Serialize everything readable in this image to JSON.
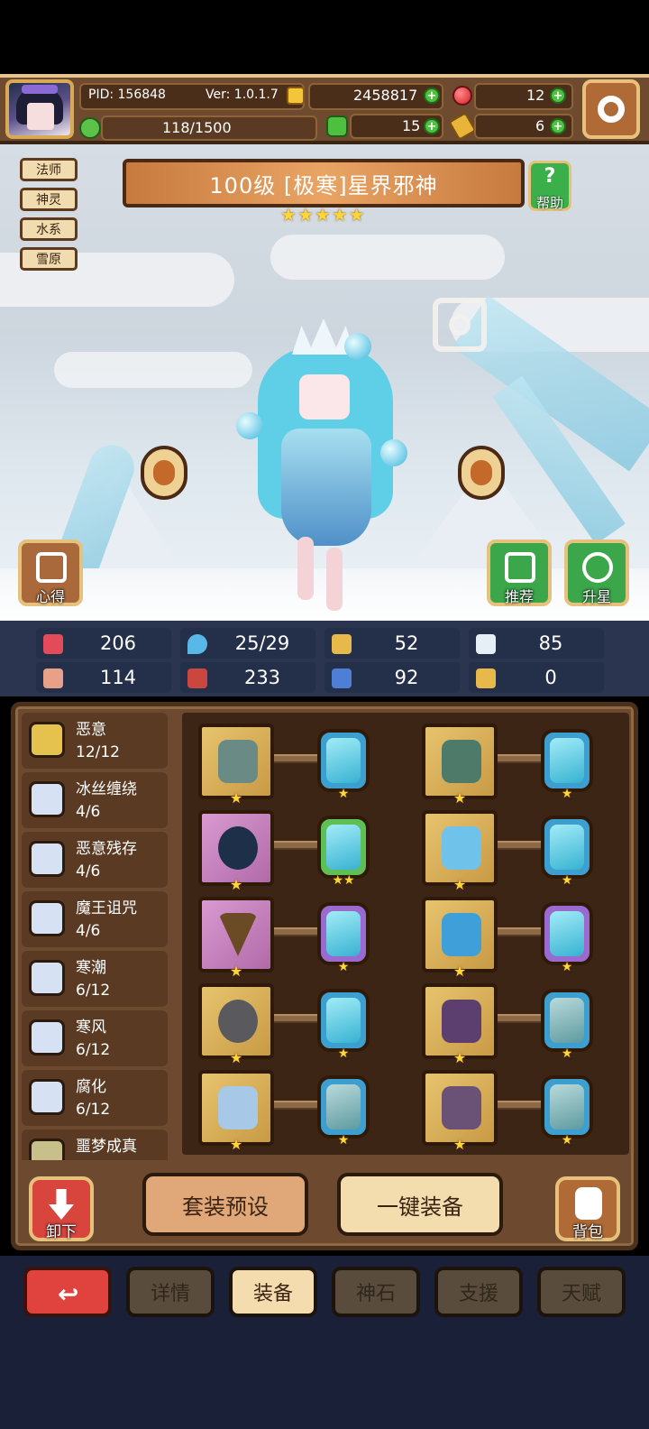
{
  "header": {
    "pid": "PID: 156848",
    "version": "Ver: 1.0.1.7",
    "gold": "2458817",
    "red_gems": "12",
    "energy": "118/1500",
    "clovers": "15",
    "keys": "6"
  },
  "tags": [
    "法师",
    "神灵",
    "水系",
    "雪原"
  ],
  "hero": {
    "title": "100级 [极寒]星界邪神",
    "stars": 5,
    "star_glyph": "★"
  },
  "buttons": {
    "help": "帮助",
    "notes": "心得",
    "recommend": "推荐",
    "star_up": "升星",
    "unequip": "卸下",
    "preset": "套装预设",
    "auto_equip": "一键装备",
    "bag": "背包"
  },
  "stats": [
    {
      "icon": "heart-icon",
      "value": "206",
      "color": "#e44b5a"
    },
    {
      "icon": "drop-icon",
      "value": "25/29",
      "color": "#5ab8e8"
    },
    {
      "icon": "shield-icon",
      "value": "52",
      "color": "#e7b84a"
    },
    {
      "icon": "wing-icon",
      "value": "85",
      "color": "#e6eef6"
    },
    {
      "icon": "fist-icon",
      "value": "114",
      "color": "#e6a188"
    },
    {
      "icon": "book-icon",
      "value": "233",
      "color": "#c9473e"
    },
    {
      "icon": "boot-icon",
      "value": "92",
      "color": "#4e7fd4"
    },
    {
      "icon": "horseshoe-icon",
      "value": "0",
      "color": "#e7b84a"
    }
  ],
  "sets": [
    {
      "name": "恶意",
      "count": "12/12",
      "color": "#e5c14e"
    },
    {
      "name": "冰丝缠绕",
      "count": "4/6",
      "color": "#d6e2f3"
    },
    {
      "name": "恶意残存",
      "count": "4/6",
      "color": "#d6e2f3"
    },
    {
      "name": "魔王诅咒",
      "count": "4/6",
      "color": "#d6e2f3"
    },
    {
      "name": "寒潮",
      "count": "6/12",
      "color": "#d6e2f3"
    },
    {
      "name": "寒风",
      "count": "6/12",
      "color": "#d6e2f3"
    },
    {
      "name": "腐化",
      "count": "6/12",
      "color": "#d6e2f3"
    },
    {
      "name": "噩梦成真",
      "count": "",
      "color": "#c7c08a"
    }
  ],
  "equipment": [
    {
      "slot": "staff",
      "frame": "gold",
      "item_color": "#6a8a86",
      "stars": "★",
      "gem_border": "#3c9fd0",
      "gem": "blue",
      "gem_stars": "★"
    },
    {
      "slot": "cloak",
      "frame": "gold",
      "item_color": "#4e7a6a",
      "stars": "★",
      "gem_border": "#3c9fd0",
      "gem": "blue",
      "gem_stars": "★"
    },
    {
      "slot": "orb",
      "frame": "pink",
      "item_color": "#1e2f4a",
      "stars": "★",
      "gem_border": "#5fbf57",
      "gem": "blue",
      "gem_stars": "★★"
    },
    {
      "slot": "robe",
      "frame": "gold",
      "item_color": "#6fc2ea",
      "stars": "★",
      "gem_border": "#3c9fd0",
      "gem": "blue",
      "gem_stars": "★"
    },
    {
      "slot": "necklace",
      "frame": "pink",
      "item_color": "#6b4a26",
      "stars": "★",
      "gem_border": "#9b6ad1",
      "gem": "blue",
      "gem_stars": "★"
    },
    {
      "slot": "gloves",
      "frame": "gold",
      "item_color": "#3f9fd8",
      "stars": "★",
      "gem_border": "#9b6ad1",
      "gem": "blue",
      "gem_stars": "★"
    },
    {
      "slot": "ring",
      "frame": "gold",
      "item_color": "#5a5a5e",
      "stars": "★",
      "gem_border": "#3c9fd0",
      "gem": "blue",
      "gem_stars": "★"
    },
    {
      "slot": "belt",
      "frame": "gold",
      "item_color": "#5c3f6e",
      "stars": "★",
      "gem_border": "#3c9fd0",
      "gem": "grey",
      "gem_stars": "★"
    },
    {
      "slot": "helm",
      "frame": "gold",
      "item_color": "#a8c8e8",
      "stars": "★",
      "gem_border": "#3c9fd0",
      "gem": "grey",
      "gem_stars": "★"
    },
    {
      "slot": "boots",
      "frame": "gold",
      "item_color": "#6a5276",
      "stars": "★",
      "gem_border": "#3c9fd0",
      "gem": "grey",
      "gem_stars": "★"
    }
  ],
  "tabs": [
    "详情",
    "装备",
    "神石",
    "支援",
    "天赋"
  ],
  "active_tab": "装备"
}
